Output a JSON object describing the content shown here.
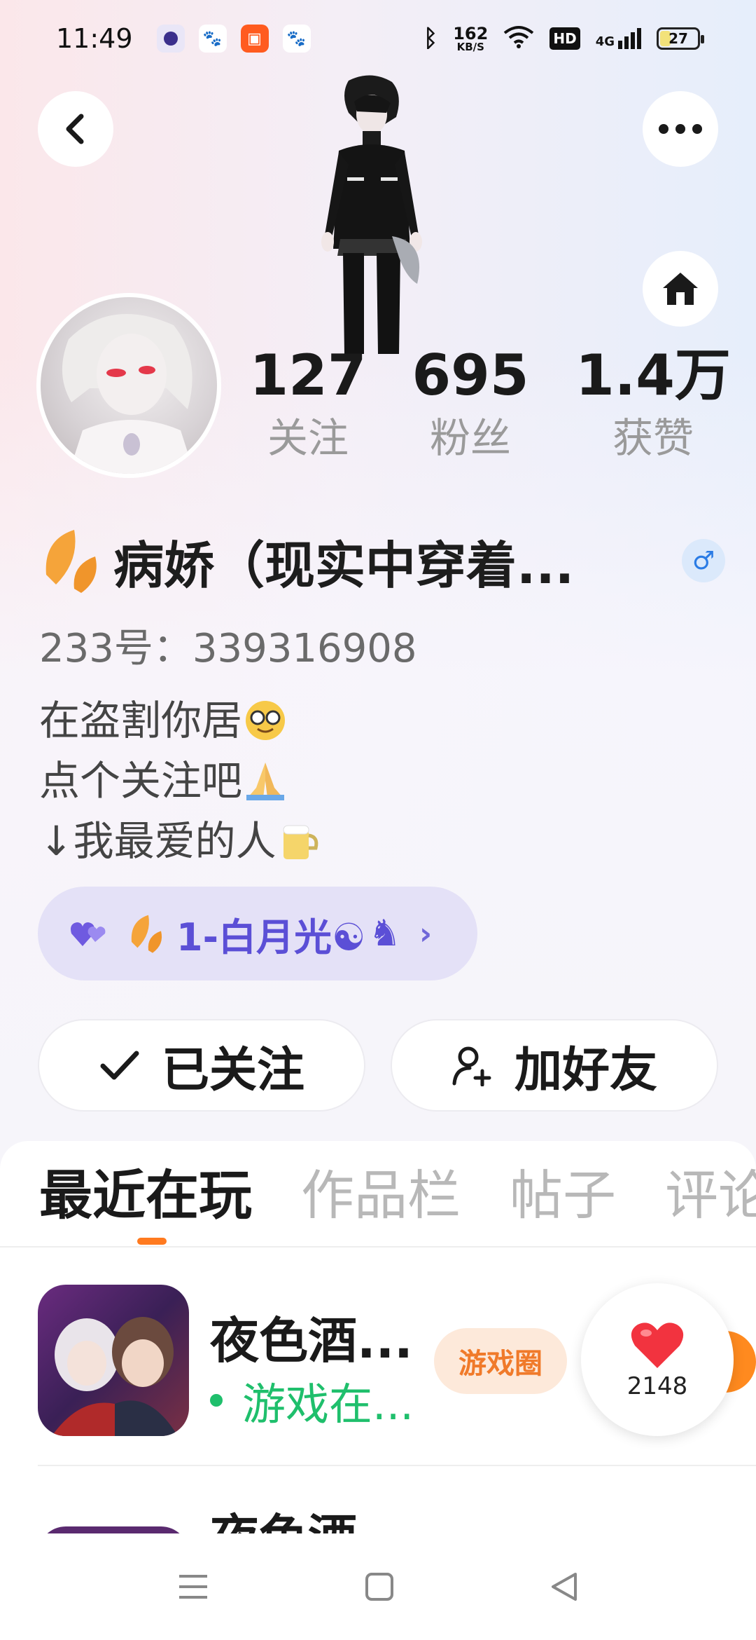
{
  "status_bar": {
    "time": "11:49",
    "net_speed_top": "162",
    "net_speed_unit": "KB/S",
    "hd_label": "HD",
    "signal_label": "4G",
    "battery": "27"
  },
  "profile": {
    "stats": [
      {
        "value": "127",
        "label": "关注"
      },
      {
        "value": "695",
        "label": "粉丝"
      },
      {
        "value": "1.4万",
        "label": "获赞"
      }
    ],
    "name": "病娇（现实中穿着...",
    "gender_symbol": "♂",
    "id_line": "233号：339316908",
    "bio": [
      "在盗割你居",
      "点个关注吧",
      "↓我最爱的人"
    ],
    "pill_label": "1-白月光☯",
    "pill_arrow": "›"
  },
  "actions": {
    "follow_label": "已关注",
    "add_friend_label": "加好友"
  },
  "tabs": [
    "最近在玩",
    "作品栏",
    "帖子",
    "评论"
  ],
  "games": [
    {
      "title": "夜色酒...",
      "status": "游戏在...",
      "circle_label": "游戏圈",
      "likes": "2148"
    },
    {
      "title": "夜色酒"
    }
  ],
  "colors": {
    "accent_orange": "#ff7a1f",
    "status_green": "#1fbf6c",
    "pill_purple": "#5b4fd6",
    "gender_blue": "#2b7ce5"
  }
}
